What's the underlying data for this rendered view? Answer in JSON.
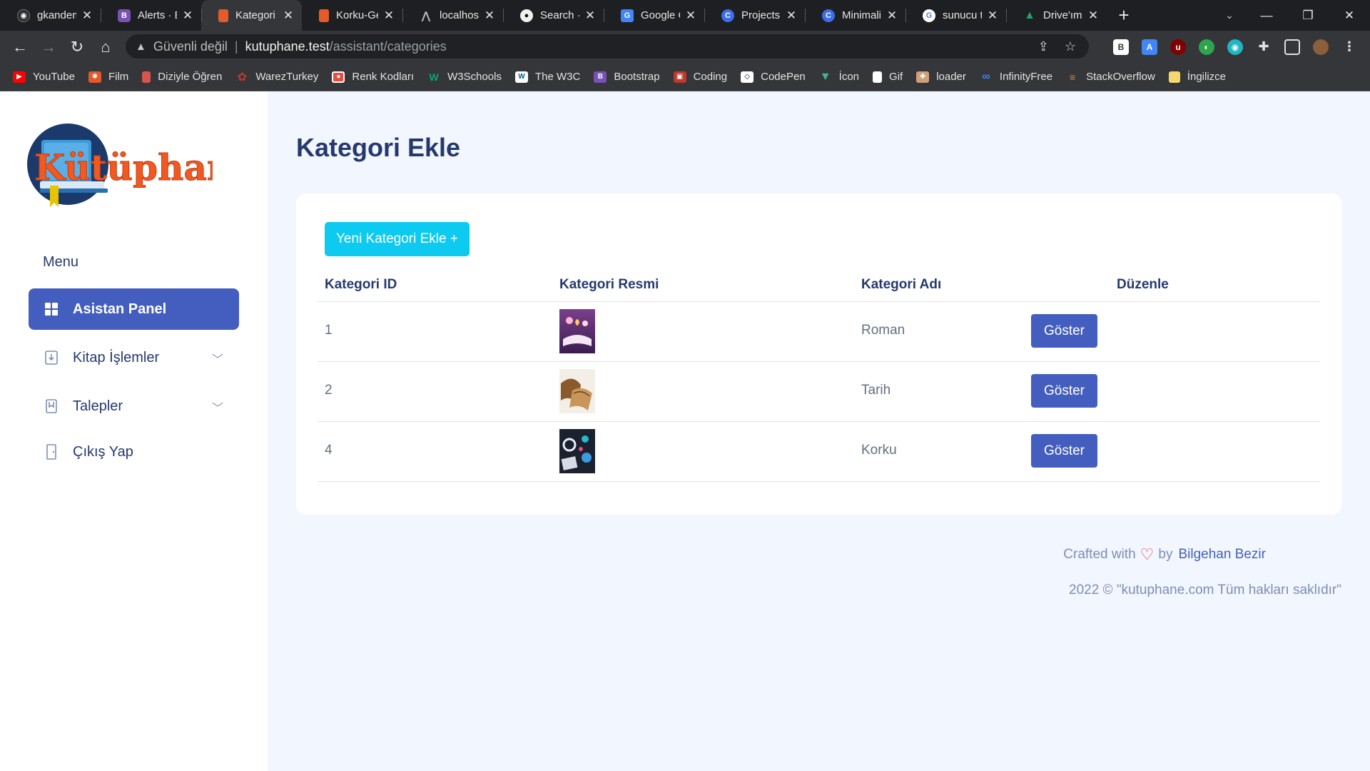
{
  "browser": {
    "tabs": [
      {
        "title": "gkandem",
        "favicon": "github-icon",
        "color": "#2b2b2b"
      },
      {
        "title": "Alerts · Bo",
        "favicon": "bootstrap-icon",
        "color": "#7952b3"
      },
      {
        "title": "Kategori E",
        "favicon": "book-icon",
        "color": "#e55a2b",
        "active": true
      },
      {
        "title": "Korku-Ge",
        "favicon": "book-icon",
        "color": "#e55a2b"
      },
      {
        "title": "localhost",
        "favicon": "laravel-icon",
        "color": "#5a5a5a"
      },
      {
        "title": "Search · f",
        "favicon": "github-icon",
        "color": "#2b2b2b"
      },
      {
        "title": "Google Ç",
        "favicon": "translate-icon",
        "color": "#4285f4"
      },
      {
        "title": "Projects ·",
        "favicon": "c-icon",
        "color": "#3b6ee8"
      },
      {
        "title": "Minimalis",
        "favicon": "c-icon",
        "color": "#3b6ee8"
      },
      {
        "title": "sunucu ta",
        "favicon": "google-icon",
        "color": "#ffffff"
      },
      {
        "title": "Drive'ım",
        "favicon": "drive-icon",
        "color": "#1fa463"
      }
    ],
    "address": {
      "security_label": "Güvenli değil",
      "host": "kutuphane.test",
      "path": "/assistant/categories"
    },
    "bookmarks": [
      {
        "label": "YouTube",
        "icon": "youtube-icon",
        "color": "#ff0000"
      },
      {
        "label": "Film",
        "icon": "film-icon",
        "color": "#e05a2b"
      },
      {
        "label": "Diziyle Öğren",
        "icon": "cup-icon",
        "color": "#d9534f"
      },
      {
        "label": "WarezTurkey",
        "icon": "gear-icon",
        "color": "#c0392b"
      },
      {
        "label": "Renk Kodları",
        "icon": "color-icon",
        "color": "#e74c3c"
      },
      {
        "label": "W3Schools",
        "icon": "w3schools-icon",
        "color": "#04aa6d"
      },
      {
        "label": "The W3C",
        "icon": "w3c-icon",
        "color": "#ffffff"
      },
      {
        "label": "Bootstrap",
        "icon": "bootstrap-icon",
        "color": "#7952b3"
      },
      {
        "label": "Coding",
        "icon": "coding-icon",
        "color": "#c0392b"
      },
      {
        "label": "CodePen",
        "icon": "codepen-icon",
        "color": "#ffffff"
      },
      {
        "label": "İcon",
        "icon": "vue-icon",
        "color": "#41b883"
      },
      {
        "label": "Gif",
        "icon": "file-icon",
        "color": "#ffffff"
      },
      {
        "label": "loader",
        "icon": "loader-icon",
        "color": "#d0a07a"
      },
      {
        "label": "InfinityFree",
        "icon": "infinity-icon",
        "color": "#3b82f6"
      },
      {
        "label": "StackOverflow",
        "icon": "stackoverflow-icon",
        "color": "#f48024"
      },
      {
        "label": "İngilizce",
        "icon": "folder-icon",
        "color": "#f5d76e"
      }
    ]
  },
  "sidebar": {
    "logo_text": "Kütüphane",
    "menu_title": "Menu",
    "items": [
      {
        "label": "Asistan Panel",
        "icon": "grid-icon",
        "active": true
      },
      {
        "label": "Kitap İşlemler",
        "icon": "download-icon",
        "has_submenu": true
      },
      {
        "label": "Talepler",
        "icon": "bookmark-icon",
        "has_submenu": true
      },
      {
        "label": "Çıkış Yap",
        "icon": "door-icon"
      }
    ]
  },
  "main": {
    "title": "Kategori Ekle",
    "add_button": "Yeni Kategori Ekle +",
    "table": {
      "headers": [
        "Kategori ID",
        "Kategori Resmi",
        "Kategori Adı",
        "Düzenle"
      ],
      "rows": [
        {
          "id": "1",
          "name": "Roman",
          "image": "roman-thumbnail",
          "action": "Göster"
        },
        {
          "id": "2",
          "name": "Tarih",
          "image": "tarih-thumbnail",
          "action": "Göster"
        },
        {
          "id": "4",
          "name": "Korku",
          "image": "korku-thumbnail",
          "action": "Göster"
        }
      ]
    }
  },
  "footer": {
    "crafted": "Crafted with",
    "by": "by",
    "author": "Bilgehan Bezir",
    "copyright": "2022 © \"kutuphane.com Tüm hakları saklıdır\""
  },
  "colors": {
    "primary": "#435ebe",
    "info": "#0dcaf0",
    "heading": "#25396f",
    "page_bg": "#f2f7ff"
  }
}
